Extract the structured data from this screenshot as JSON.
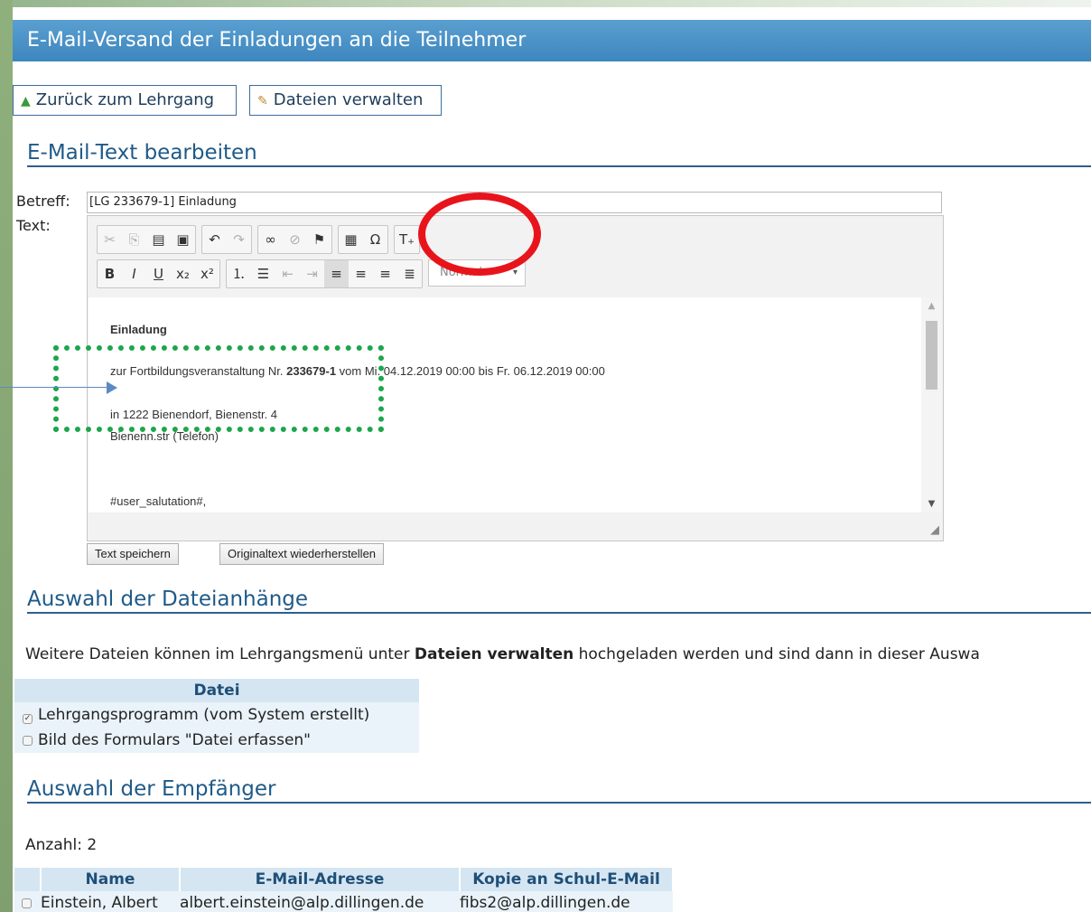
{
  "title": "E-Mail-Versand der Einladungen an die Teilnehmer",
  "nav": {
    "back_label": "Zurück zum Lehrgang",
    "files_label": "Dateien verwalten"
  },
  "email_section": {
    "heading": "E-Mail-Text bearbeiten",
    "subject_label": "Betreff:",
    "subject_value": "[LG 233679-1] Einladung",
    "text_label": "Text:",
    "format_select": "Normal",
    "body": {
      "line1": "Einladung",
      "line2_prefix": "zur Fortbildungsveranstaltung Nr. ",
      "line2_number": "233679-1",
      "line2_suffix": " vom Mi. 04.12.2019 00:00 bis Fr. 06.12.2019 00:00",
      "line3": "in 1222 Bienendorf, Bienenstr. 4",
      "line4": "Bienenn.str (Telefon)",
      "line5": "#user_salutation#,"
    },
    "save_button": "Text speichern",
    "restore_button": "Originaltext wiederherstellen"
  },
  "toolbar_icons": [
    "cut-icon",
    "copy-icon",
    "paste-icon",
    "paste-word-icon",
    "undo-icon",
    "redo-icon",
    "link-icon",
    "unlink-icon",
    "anchor-icon",
    "table-icon",
    "special-char-icon",
    "placeholder-icon",
    "bold-icon",
    "italic-icon",
    "underline-icon",
    "subscript-icon",
    "superscript-icon",
    "numbered-list-icon",
    "bulleted-list-icon",
    "outdent-icon",
    "indent-icon",
    "align-left-icon",
    "align-center-icon",
    "align-right-icon",
    "justify-icon"
  ],
  "attachments": {
    "heading": "Auswahl der Dateianhänge",
    "info_prefix": "Weitere Dateien können im Lehrgangsmenü unter ",
    "info_bold": "Dateien verwalten",
    "info_suffix": " hochgeladen werden und sind dann in dieser Auswa",
    "column": "Datei",
    "files": [
      {
        "name": "Lehrgangsprogramm (vom System erstellt)",
        "checked": true
      },
      {
        "name": "Bild des Formulars \"Datei erfassen\"",
        "checked": false
      }
    ]
  },
  "recipients": {
    "heading": "Auswahl der Empfänger",
    "count_label": "Anzahl: 2",
    "columns": [
      "Name",
      "E-Mail-Adresse",
      "Kopie an Schul-E-Mail"
    ],
    "rows": [
      {
        "name": "Einstein, Albert",
        "email": "albert.einstein@alp.dillingen.de",
        "copy": "fibs2@alp.dillingen.de"
      }
    ]
  },
  "colors": {
    "title_bar": "#3d86bf",
    "heading": "#1f5a88",
    "highlight_circle": "#e8141c",
    "highlight_box": "#1da64a",
    "arrow": "#5a8ac4"
  }
}
